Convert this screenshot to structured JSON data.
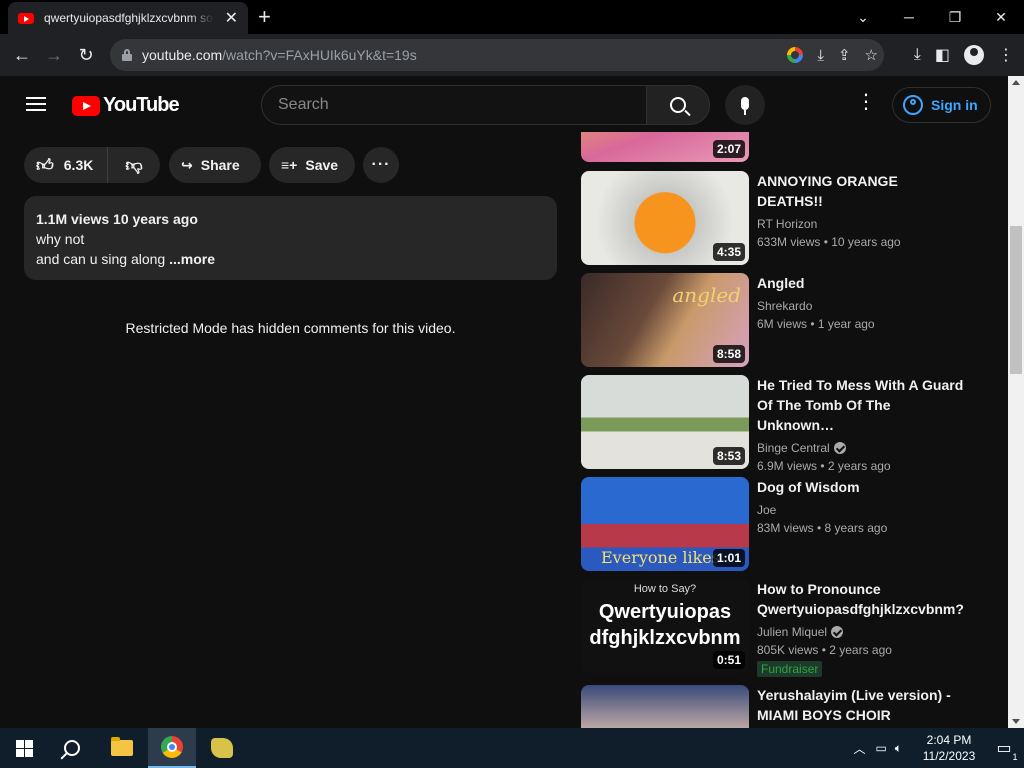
{
  "browser": {
    "tab_title": "qwertyuiopasdfghjklzxcvbnm song",
    "new_tab": "+",
    "url_domain": "youtube.com",
    "url_path": "/watch?v=FAxHUIk6uYk&t=19s"
  },
  "header": {
    "logo_text": "YouTube",
    "search_placeholder": "Search",
    "sign_in": "Sign in"
  },
  "actions": {
    "likes": "6.3K",
    "share": "Share",
    "save": "Save",
    "more": "···"
  },
  "description": {
    "meta": "1.1M views  10 years ago",
    "line1": "why not",
    "line2": "and can u sing along ",
    "more": "...more"
  },
  "comments_notice": "Restricted Mode has hidden comments for this video.",
  "recommendations": [
    {
      "title": "",
      "channel": "",
      "views": "",
      "duration": "2:07",
      "verified": false,
      "fundraiser": ""
    },
    {
      "title": "ANNOYING ORANGE DEATHS!!",
      "channel": "RT Horizon",
      "views": "633M views  • 10 years ago",
      "duration": "4:35",
      "verified": false,
      "fundraiser": ""
    },
    {
      "title": "Angled",
      "channel": "Shrekardo",
      "views": "6M views  • 1 year ago",
      "duration": "8:58",
      "verified": false,
      "fundraiser": "",
      "thumb_text": "angled"
    },
    {
      "title": "He Tried To Mess With A Guard Of The Tomb Of The Unknown…",
      "channel": "Binge Central",
      "views": "6.9M views  • 2 years ago",
      "duration": "8:53",
      "verified": true,
      "fundraiser": ""
    },
    {
      "title": "Dog of Wisdom",
      "channel": "Joe",
      "views": "83M views  • 8 years ago",
      "duration": "1:01",
      "verified": false,
      "fundraiser": "",
      "thumb_text": "Everyone likes"
    },
    {
      "title": "How to Pronounce Qwertyuiopasdfghjklzxcvbnm?",
      "channel": "Julien Miquel",
      "views": "805K views  • 2 years ago",
      "duration": "0:51",
      "verified": true,
      "fundraiser": "Fundraiser",
      "thumb_small": "How to Say?",
      "thumb_line1": "Qwertyuiopas",
      "thumb_line2": "dfghjklzxcvbnm"
    },
    {
      "title": "Yerushalayim (Live version) - MIAMI BOYS CHOIR",
      "channel": "",
      "views": "",
      "duration": "",
      "verified": false,
      "fundraiser": ""
    }
  ],
  "taskbar": {
    "time": "2:04 PM",
    "date": "11/2/2023",
    "notif_count": "1"
  }
}
